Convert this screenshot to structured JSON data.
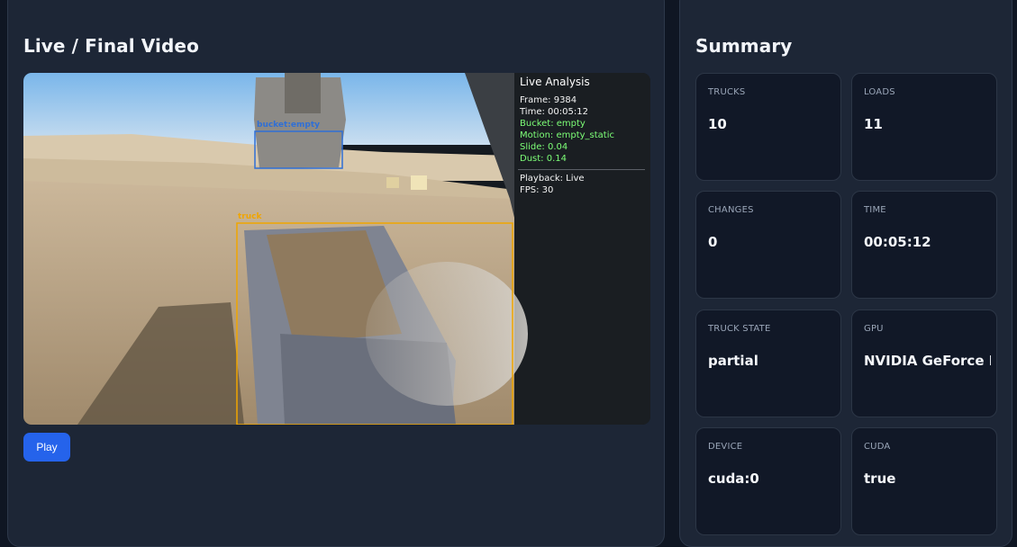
{
  "video_panel": {
    "title": "Live / Final Video",
    "play_label": "Play",
    "overlay": {
      "title": "Live Analysis",
      "frame": "Frame: 9384",
      "time": "Time: 00:05:12",
      "bucket": "Bucket: empty",
      "motion": "Motion: empty_static",
      "slide": "Slide: 0.04",
      "dust": "Dust: 0.14",
      "playback": "Playback: Live",
      "fps": "FPS: 30"
    },
    "detections": {
      "bucket_label": "bucket:empty",
      "truck_label": "truck"
    },
    "colors": {
      "bucket_box": "#2f6fd6",
      "truck_box": "#f0a500",
      "overlay_green": "#7dff77"
    }
  },
  "summary": {
    "title": "Summary",
    "cards": [
      {
        "label": "TRUCKS",
        "value": "10"
      },
      {
        "label": "LOADS",
        "value": "11"
      },
      {
        "label": "CHANGES",
        "value": "0"
      },
      {
        "label": "TIME",
        "value": "00:05:12"
      },
      {
        "label": "TRUCK STATE",
        "value": "partial"
      },
      {
        "label": "GPU",
        "value": "NVIDIA GeForce R"
      },
      {
        "label": "DEVICE",
        "value": "cuda:0"
      },
      {
        "label": "CUDA",
        "value": "true"
      }
    ]
  },
  "colors": {
    "background": "#0f1623",
    "panel": "#1d2636",
    "card": "#111827",
    "accent": "#2563eb"
  }
}
